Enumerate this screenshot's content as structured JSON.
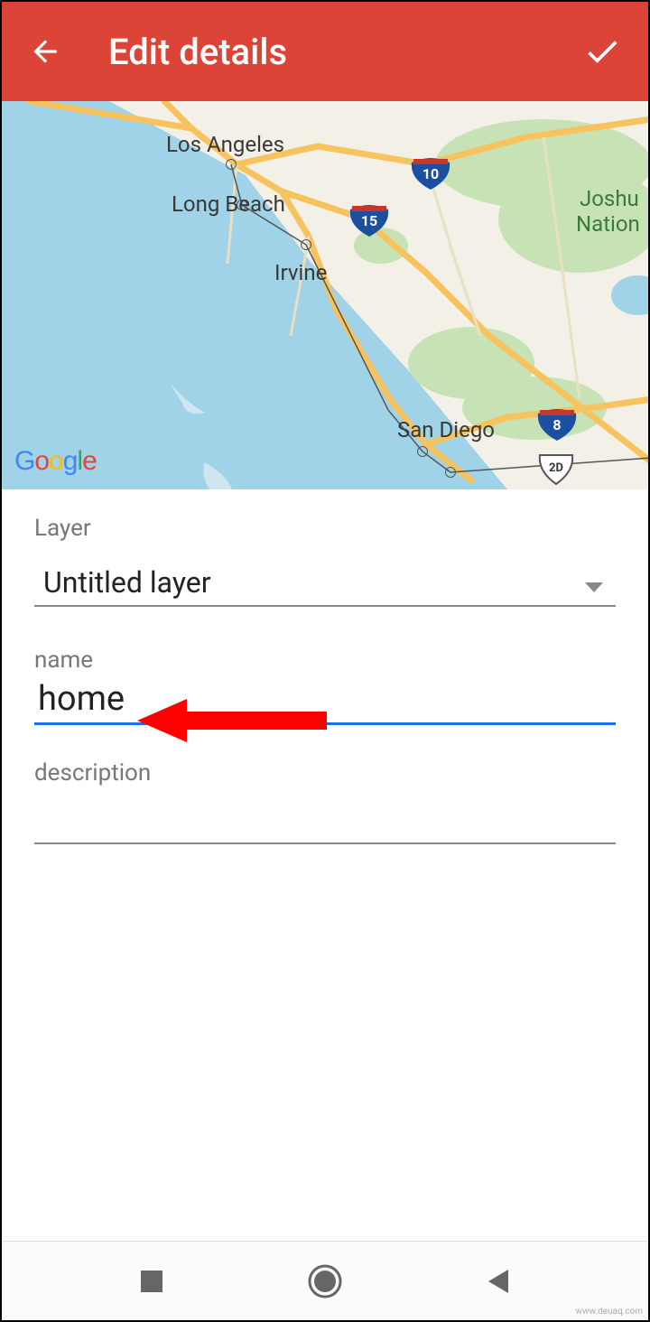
{
  "header": {
    "title": "Edit details"
  },
  "map": {
    "labels": {
      "los_angeles": "Los Angeles",
      "long_beach": "Long Beach",
      "irvine": "Irvine",
      "san_diego": "San Diego",
      "joshua": "Joshu",
      "national": "Nation"
    },
    "shields": {
      "i10": "10",
      "i15": "15",
      "i8": "8",
      "us2d": "2D"
    },
    "attribution": {
      "g1": "G",
      "g2": "o",
      "g3": "o",
      "g4": "g",
      "g5": "l",
      "g6": "e"
    }
  },
  "form": {
    "layer_label": "Layer",
    "layer_value": "Untitled layer",
    "name_label": "name",
    "name_value": "home",
    "description_label": "description",
    "description_value": ""
  },
  "footer": {
    "watermark": "www.deuaq.com"
  }
}
